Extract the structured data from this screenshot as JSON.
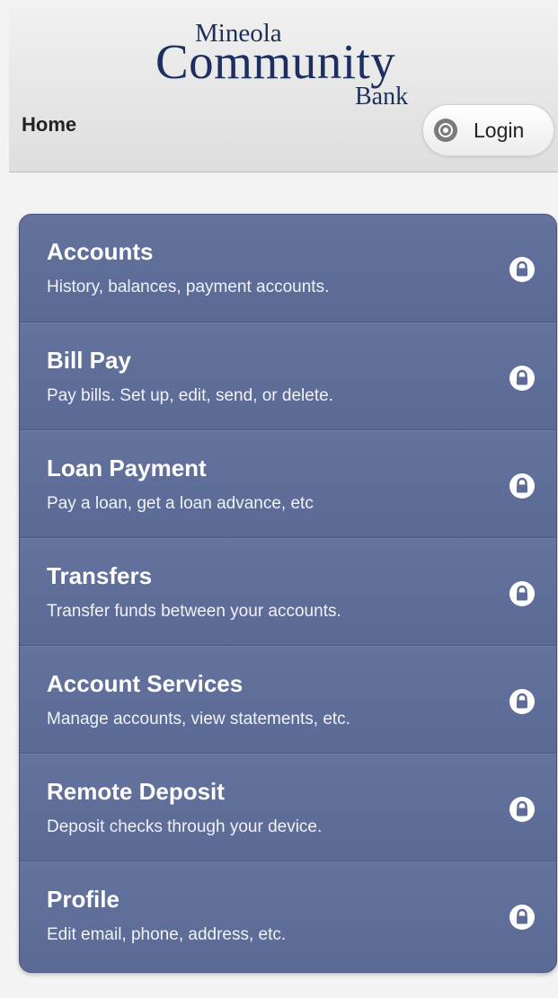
{
  "header": {
    "logo": {
      "line1": "Mineola",
      "line2": "Community",
      "line3": "Bank"
    },
    "breadcrumb": "Home",
    "login_label": "Login",
    "login_icon": "gear-icon"
  },
  "menu": {
    "lock_icon": "lock-icon",
    "items": [
      {
        "title": "Accounts",
        "subtitle": "History, balances, payment accounts."
      },
      {
        "title": "Bill Pay",
        "subtitle": "Pay bills. Set up, edit, send, or delete."
      },
      {
        "title": "Loan Payment",
        "subtitle": "Pay a loan, get a loan advance, etc"
      },
      {
        "title": "Transfers",
        "subtitle": "Transfer funds between your accounts."
      },
      {
        "title": "Account Services",
        "subtitle": "Manage accounts, view statements, etc."
      },
      {
        "title": "Remote Deposit",
        "subtitle": "Deposit checks through your device."
      },
      {
        "title": "Profile",
        "subtitle": "Edit email, phone, address, etc."
      }
    ]
  },
  "colors": {
    "brand_navy": "#1d2f5e",
    "menu_bg": "#5c6b98",
    "header_bg": "#e6e6e6"
  }
}
